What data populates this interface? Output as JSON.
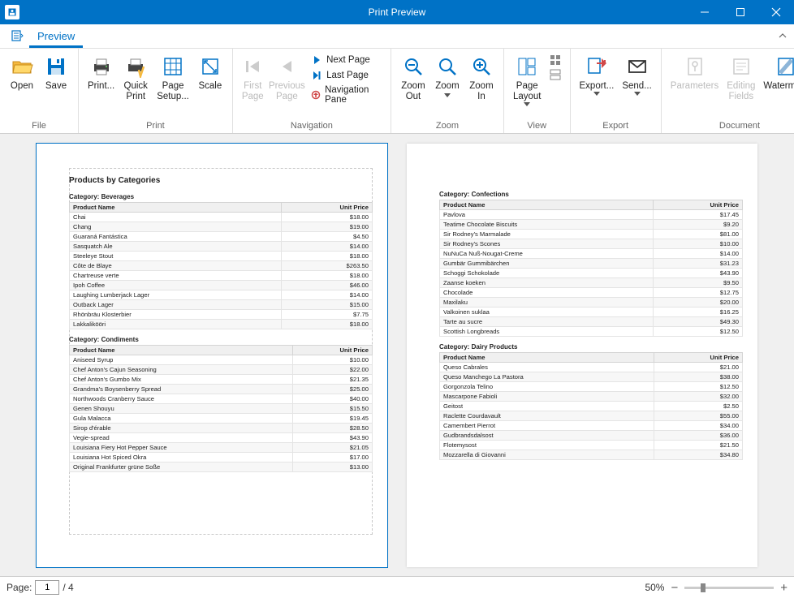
{
  "window": {
    "title": "Print Preview"
  },
  "tabs": {
    "preview": "Preview"
  },
  "ribbon": {
    "file": {
      "label": "File",
      "open": "Open",
      "save": "Save"
    },
    "print": {
      "label": "Print",
      "print": "Print...",
      "quick": "Quick\nPrint",
      "setup": "Page\nSetup...",
      "scale": "Scale"
    },
    "nav": {
      "label": "Navigation",
      "first": "First\nPage",
      "prev": "Previous\nPage",
      "next": "Next Page",
      "last": "Last Page",
      "pane": "Navigation Pane"
    },
    "zoom": {
      "label": "Zoom",
      "out": "Zoom\nOut",
      "zoom": "Zoom",
      "in": "Zoom\nIn"
    },
    "view": {
      "label": "View",
      "layout": "Page\nLayout"
    },
    "export": {
      "label": "Export",
      "export": "Export...",
      "send": "Send..."
    },
    "doc": {
      "label": "Document",
      "params": "Parameters",
      "fields": "Editing\nFields",
      "wm": "Watermark"
    }
  },
  "status": {
    "page_label": "Page:",
    "page_value": "1",
    "page_total": "/ 4",
    "zoom": "50%"
  },
  "report": {
    "title": "Products by Categories",
    "col_name": "Product Name",
    "col_price": "Unit Price",
    "page1": [
      {
        "cat": "Category: Beverages",
        "rows": [
          [
            "Chai",
            "$18.00"
          ],
          [
            "Chang",
            "$19.00"
          ],
          [
            "Guaraná Fantástica",
            "$4.50"
          ],
          [
            "Sasquatch Ale",
            "$14.00"
          ],
          [
            "Steeleye Stout",
            "$18.00"
          ],
          [
            "Côte de Blaye",
            "$263.50"
          ],
          [
            "Chartreuse verte",
            "$18.00"
          ],
          [
            "Ipoh Coffee",
            "$46.00"
          ],
          [
            "Laughing Lumberjack Lager",
            "$14.00"
          ],
          [
            "Outback Lager",
            "$15.00"
          ],
          [
            "Rhönbräu Klosterbier",
            "$7.75"
          ],
          [
            "Lakkalikööri",
            "$18.00"
          ]
        ]
      },
      {
        "cat": "Category: Condiments",
        "rows": [
          [
            "Aniseed Syrup",
            "$10.00"
          ],
          [
            "Chef Anton's Cajun Seasoning",
            "$22.00"
          ],
          [
            "Chef Anton's Gumbo Mix",
            "$21.35"
          ],
          [
            "Grandma's Boysenberry Spread",
            "$25.00"
          ],
          [
            "Northwoods Cranberry Sauce",
            "$40.00"
          ],
          [
            "Genen Shouyu",
            "$15.50"
          ],
          [
            "Gula Malacca",
            "$19.45"
          ],
          [
            "Sirop d'érable",
            "$28.50"
          ],
          [
            "Vegie-spread",
            "$43.90"
          ],
          [
            "Louisiana Fiery Hot Pepper Sauce",
            "$21.05"
          ],
          [
            "Louisiana Hot Spiced Okra",
            "$17.00"
          ],
          [
            "Original Frankfurter grüne Soße",
            "$13.00"
          ]
        ]
      }
    ],
    "page2": [
      {
        "cat": "Category: Confections",
        "rows": [
          [
            "Pavlova",
            "$17.45"
          ],
          [
            "Teatime Chocolate Biscuits",
            "$9.20"
          ],
          [
            "Sir Rodney's Marmalade",
            "$81.00"
          ],
          [
            "Sir Rodney's Scones",
            "$10.00"
          ],
          [
            "NuNuCa Nuß-Nougat-Creme",
            "$14.00"
          ],
          [
            "Gumbär Gummibärchen",
            "$31.23"
          ],
          [
            "Schoggi Schokolade",
            "$43.90"
          ],
          [
            "Zaanse koeken",
            "$9.50"
          ],
          [
            "Chocolade",
            "$12.75"
          ],
          [
            "Maxilaku",
            "$20.00"
          ],
          [
            "Valkoinen suklaa",
            "$16.25"
          ],
          [
            "Tarte au sucre",
            "$49.30"
          ],
          [
            "Scottish Longbreads",
            "$12.50"
          ]
        ]
      },
      {
        "cat": "Category: Dairy Products",
        "rows": [
          [
            "Queso Cabrales",
            "$21.00"
          ],
          [
            "Queso Manchego La Pastora",
            "$38.00"
          ],
          [
            "Gorgonzola Telino",
            "$12.50"
          ],
          [
            "Mascarpone Fabioli",
            "$32.00"
          ],
          [
            "Geitost",
            "$2.50"
          ],
          [
            "Raclette Courdavault",
            "$55.00"
          ],
          [
            "Camembert Pierrot",
            "$34.00"
          ],
          [
            "Gudbrandsdalsost",
            "$36.00"
          ],
          [
            "Flotemysost",
            "$21.50"
          ],
          [
            "Mozzarella di Giovanni",
            "$34.80"
          ]
        ]
      }
    ]
  }
}
